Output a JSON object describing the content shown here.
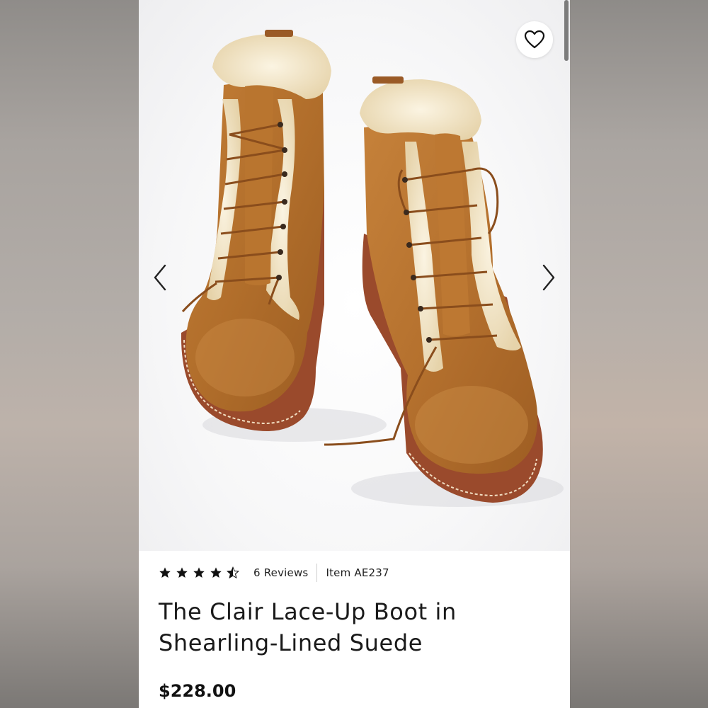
{
  "product": {
    "rating_value": 4.5,
    "rating_max": 5,
    "reviews_label": "6 Reviews",
    "item_label": "Item AE237",
    "title": "The Clair Lace-Up Boot in Shearling-Lined Suede",
    "price": "$228.00"
  },
  "icons": {
    "favorite": "heart-icon",
    "previous": "chevron-left-icon",
    "next": "chevron-right-icon",
    "rating": "star-icon"
  },
  "colors": {
    "suede": "#b8732e",
    "shearling": "#f2e6c9",
    "sole": "#9a4a2c",
    "text": "#1a1a1a"
  }
}
